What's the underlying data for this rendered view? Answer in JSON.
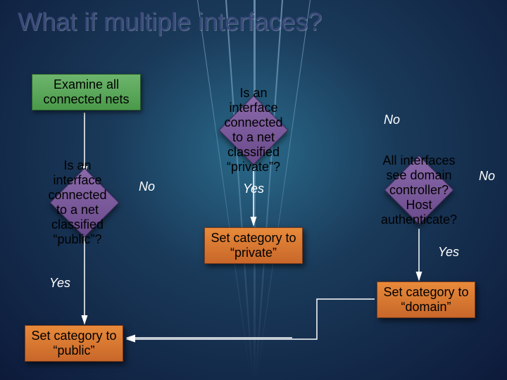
{
  "title": "What if multiple interfaces?",
  "nodes": {
    "start": "Examine all connected nets",
    "decision_public": "Is an interface connected to a net classified “public”?",
    "decision_private": "Is an interface connected to a net classified “private”?",
    "decision_domain": "All interfaces see domain controller? Host authenticate?",
    "action_public": "Set category to “public”",
    "action_private": "Set category to “private”",
    "action_domain": "Set category to “domain”"
  },
  "labels": {
    "yes": "Yes",
    "no": "No"
  }
}
